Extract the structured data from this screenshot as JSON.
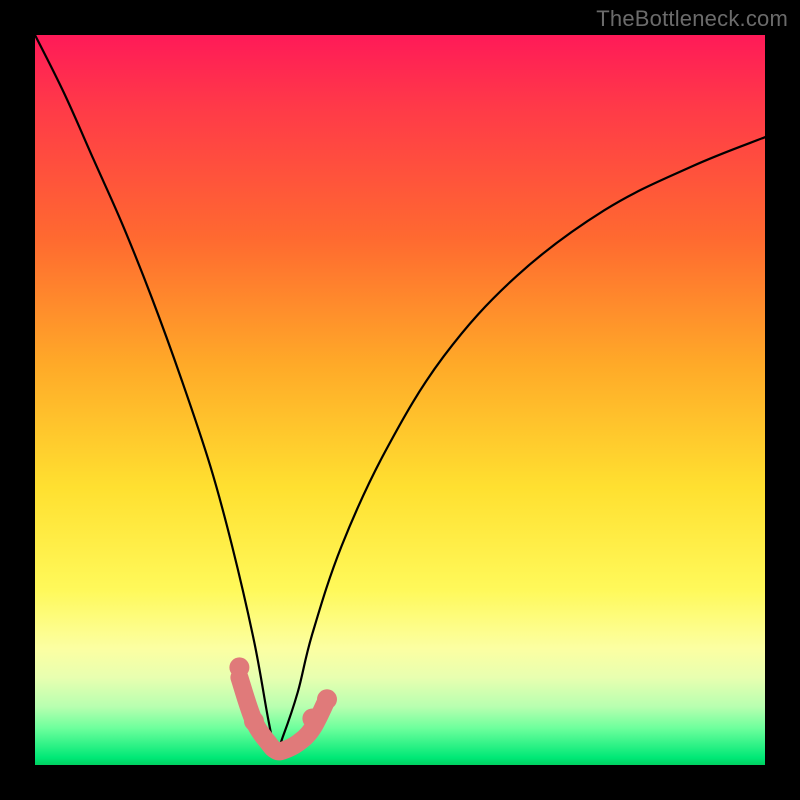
{
  "watermark": "TheBottleneck.com",
  "chart_data": {
    "type": "line",
    "title": "",
    "xlabel": "",
    "ylabel": "",
    "xlim": [
      0,
      100
    ],
    "ylim": [
      0,
      100
    ],
    "grid": false,
    "legend": false,
    "axes_visible": false,
    "curve": {
      "description": "V-shaped bottleneck curve plunging to a narrow valley near x≈33 then rising with diminishing slope",
      "x": [
        0,
        4,
        8,
        12,
        16,
        20,
        24,
        27,
        30,
        32,
        33,
        34,
        36,
        38,
        42,
        48,
        56,
        66,
        78,
        90,
        100
      ],
      "y": [
        100,
        92,
        83,
        74,
        64,
        53,
        41,
        30,
        17,
        6,
        2,
        4,
        10,
        18,
        30,
        43,
        56,
        67,
        76,
        82,
        86
      ]
    },
    "valley_marker": {
      "description": "salmon highlighted segment at the curve minimum with dotted lobes",
      "x": [
        28,
        30,
        32,
        33,
        34,
        36,
        38,
        40
      ],
      "y": [
        12,
        6,
        3,
        2,
        2,
        3,
        5,
        9
      ]
    },
    "background_gradient": {
      "orientation": "vertical",
      "stops": [
        {
          "pos": 0.0,
          "color": "#ff1a58"
        },
        {
          "pos": 0.28,
          "color": "#ff6a30"
        },
        {
          "pos": 0.62,
          "color": "#ffe030"
        },
        {
          "pos": 0.86,
          "color": "#fcffa2"
        },
        {
          "pos": 0.95,
          "color": "#6cff9c"
        },
        {
          "pos": 1.0,
          "color": "#00d060"
        }
      ]
    }
  }
}
